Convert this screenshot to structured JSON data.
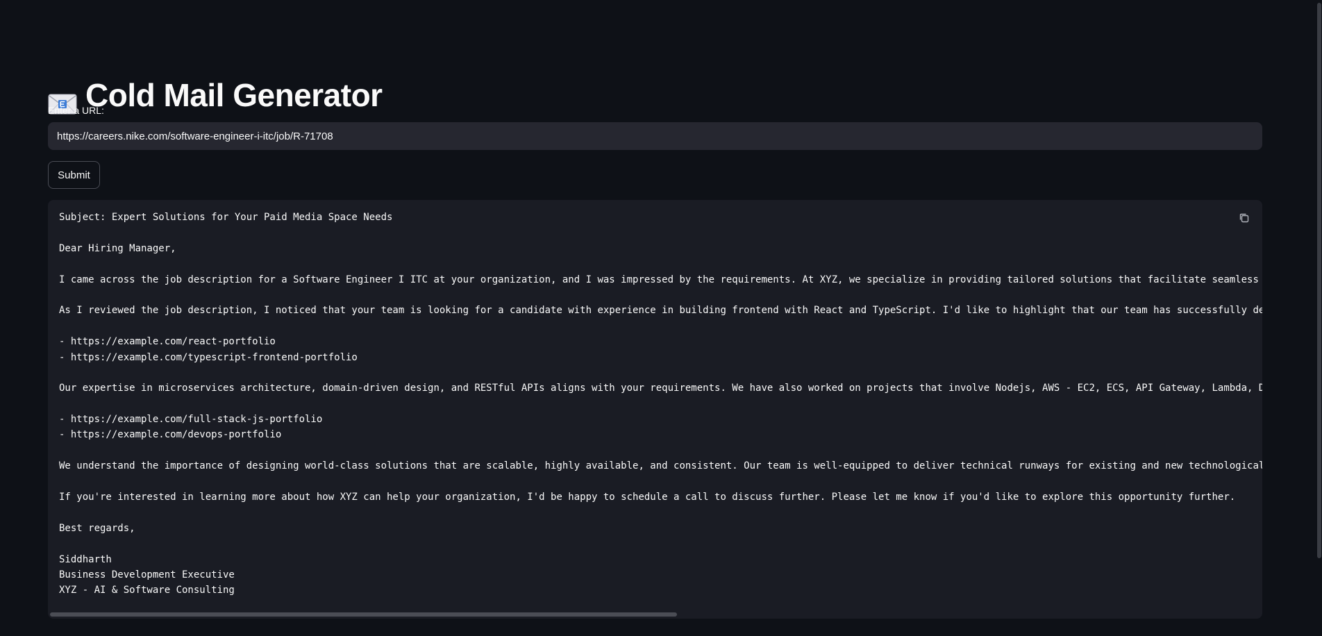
{
  "app": {
    "title": "Cold Mail Generator",
    "title_icon": "envelope-icon"
  },
  "url_field": {
    "label": "Enter a URL:",
    "value": "https://careers.nike.com/software-engineer-i-itc/job/R-71708"
  },
  "submit": {
    "label": "Submit"
  },
  "email": {
    "copy_icon": "copy-icon",
    "lines": [
      "Subject: Expert Solutions for Your Paid Media Space Needs",
      "",
      "Dear Hiring Manager,",
      "",
      "I came across the job description for a Software Engineer I ITC at your organization, and I was impressed by the requirements. At XYZ, we specialize in providing tailored solutions that facilitate seamless t",
      "",
      "As I reviewed the job description, I noticed that your team is looking for a candidate with experience in building frontend with React and TypeScript. I'd like to highlight that our team has successfully del",
      "",
      "- https://example.com/react-portfolio",
      "- https://example.com/typescript-frontend-portfolio",
      "",
      "Our expertise in microservices architecture, domain-driven design, and RESTful APIs aligns with your requirements. We have also worked on projects that involve Nodejs, AWS - EC2, ECS, API Gateway, Lambda, Dy",
      "",
      "- https://example.com/full-stack-js-portfolio",
      "- https://example.com/devops-portfolio",
      "",
      "We understand the importance of designing world-class solutions that are scalable, highly available, and consistent. Our team is well-equipped to deliver technical runways for existing and new technological",
      "",
      "If you're interested in learning more about how XYZ can help your organization, I'd be happy to schedule a call to discuss further. Please let me know if you'd like to explore this opportunity further.",
      "",
      "Best regards,",
      "",
      "Siddharth",
      "Business Development Executive",
      "XYZ - AI & Software Consulting"
    ]
  },
  "colors": {
    "background": "#0e1117",
    "input_bg": "#262730",
    "code_bg": "#1a1c24",
    "text": "#fafafa"
  }
}
